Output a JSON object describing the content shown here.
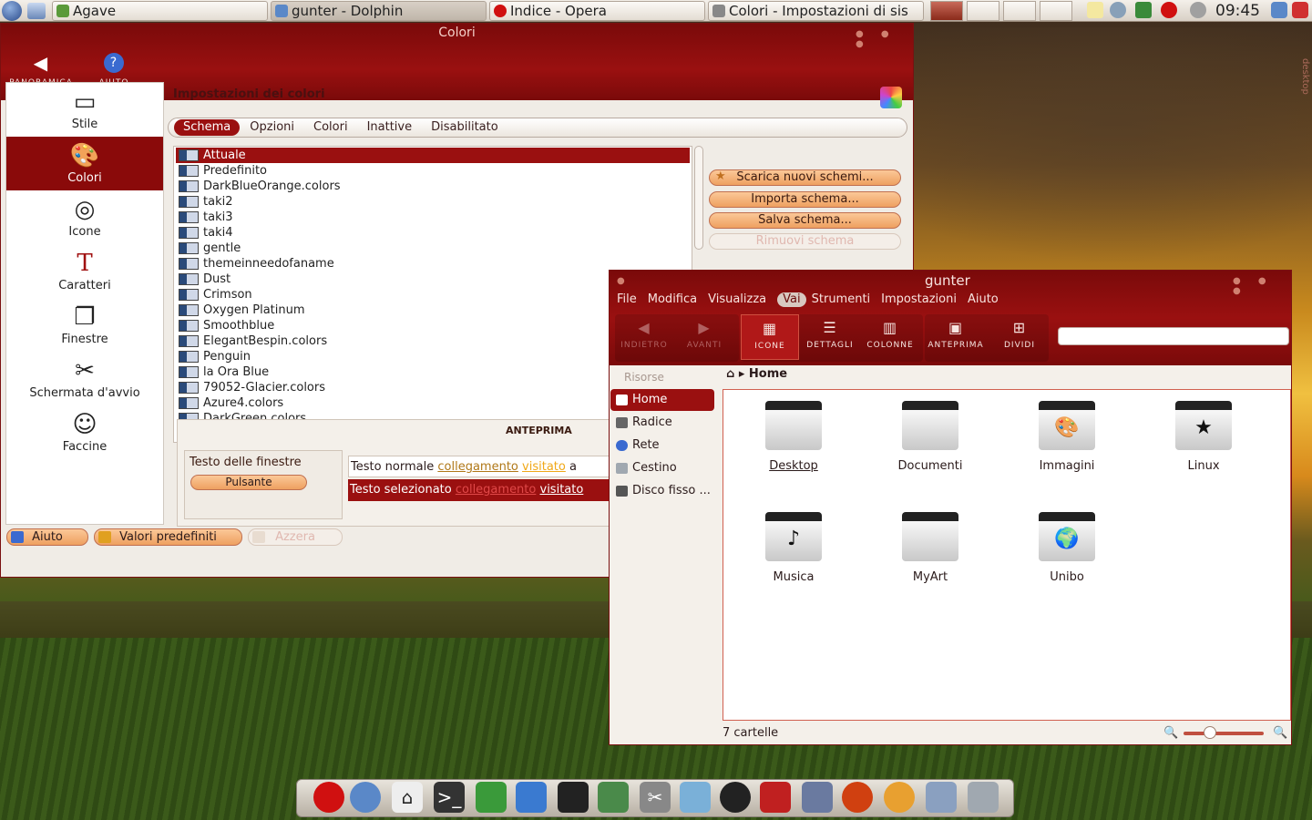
{
  "colors": {
    "accent": "#9a1010",
    "button": "#eea060"
  },
  "taskbar": {
    "tasks": [
      {
        "label": "Agave",
        "icon": "agave-icon"
      },
      {
        "label": "gunter - Dolphin",
        "icon": "dolphin-icon"
      },
      {
        "label": "Indice - Opera",
        "icon": "opera-icon"
      },
      {
        "label": "Colori - Impostazioni di sis",
        "icon": "settings-icon"
      }
    ],
    "clock": "09:45"
  },
  "colori": {
    "title": "Colori",
    "header_buttons": {
      "overview": "PANORAMICA",
      "help": "AIUTO"
    },
    "sidebar": [
      {
        "label": "Stile",
        "icon": "style-icon"
      },
      {
        "label": "Colori",
        "icon": "colors-icon"
      },
      {
        "label": "Icone",
        "icon": "icons-icon"
      },
      {
        "label": "Caratteri",
        "icon": "fonts-icon"
      },
      {
        "label": "Finestre",
        "icon": "windows-icon"
      },
      {
        "label": "Schermata d'avvio",
        "icon": "splash-icon"
      },
      {
        "label": "Faccine",
        "icon": "emoticons-icon"
      }
    ],
    "page_title": "Impostazioni dei colori",
    "tabs": [
      "Schema",
      "Opzioni",
      "Colori",
      "Inattive",
      "Disabilitato"
    ],
    "schemes": [
      "Attuale",
      "Predefinito",
      "DarkBlueOrange.colors",
      "taki2",
      "taki3",
      "taki4",
      "gentle",
      "themeinneedofaname",
      "Dust",
      "Crimson",
      "Oxygen Platinum",
      "Smoothblue",
      "ElegantBespin.colors",
      "Penguin",
      "la Ora Blue",
      "79052-Glacier.colors",
      "Azure4.colors",
      "DarkGreen.colors"
    ],
    "side_buttons": {
      "download": "Scarica nuovi schemi...",
      "import": "Importa schema...",
      "save": "Salva schema...",
      "remove": "Rimuovi schema"
    },
    "preview": {
      "label": "ANTEPRIMA",
      "window_text": "Testo delle finestre",
      "button": "Pulsante",
      "normal_text": "Testo normale",
      "link": "collegamento",
      "visited": "visitato",
      "normal_tail": "a",
      "selected_text": "Testo selezionato",
      "selected_link": "collegamento",
      "selected_visited": "visitato"
    },
    "bottom": {
      "help": "Aiuto",
      "defaults": "Valori predefiniti",
      "reset": "Azzera"
    }
  },
  "dolphin": {
    "title": "gunter",
    "menu": [
      "File",
      "Modifica",
      "Visualizza",
      "Vai",
      "Strumenti",
      "Impostazioni",
      "Aiuto"
    ],
    "toolbar": {
      "back": "INDIETRO",
      "forward": "AVANTI",
      "icons": "ICONE",
      "details": "DETTAGLI",
      "columns": "COLONNE",
      "preview": "ANTEPRIMA",
      "split": "DIVIDI"
    },
    "places_title": "Risorse",
    "places": [
      {
        "label": "Home",
        "icon": "home-icon"
      },
      {
        "label": "Radice",
        "icon": "root-icon"
      },
      {
        "label": "Rete",
        "icon": "network-icon"
      },
      {
        "label": "Cestino",
        "icon": "trash-icon"
      },
      {
        "label": "Disco fisso ...",
        "icon": "harddisk-icon"
      }
    ],
    "breadcrumb": "Home",
    "folders": [
      {
        "label": "Desktop",
        "glyph": ""
      },
      {
        "label": "Documenti",
        "glyph": ""
      },
      {
        "label": "Immagini",
        "glyph": "🎨"
      },
      {
        "label": "Linux",
        "glyph": "★"
      },
      {
        "label": "Musica",
        "glyph": "♪"
      },
      {
        "label": "MyArt",
        "glyph": ""
      },
      {
        "label": "Unibo",
        "glyph": "🌍"
      }
    ],
    "status": "7 cartelle"
  },
  "desktop": {
    "side_label": "desktop"
  }
}
